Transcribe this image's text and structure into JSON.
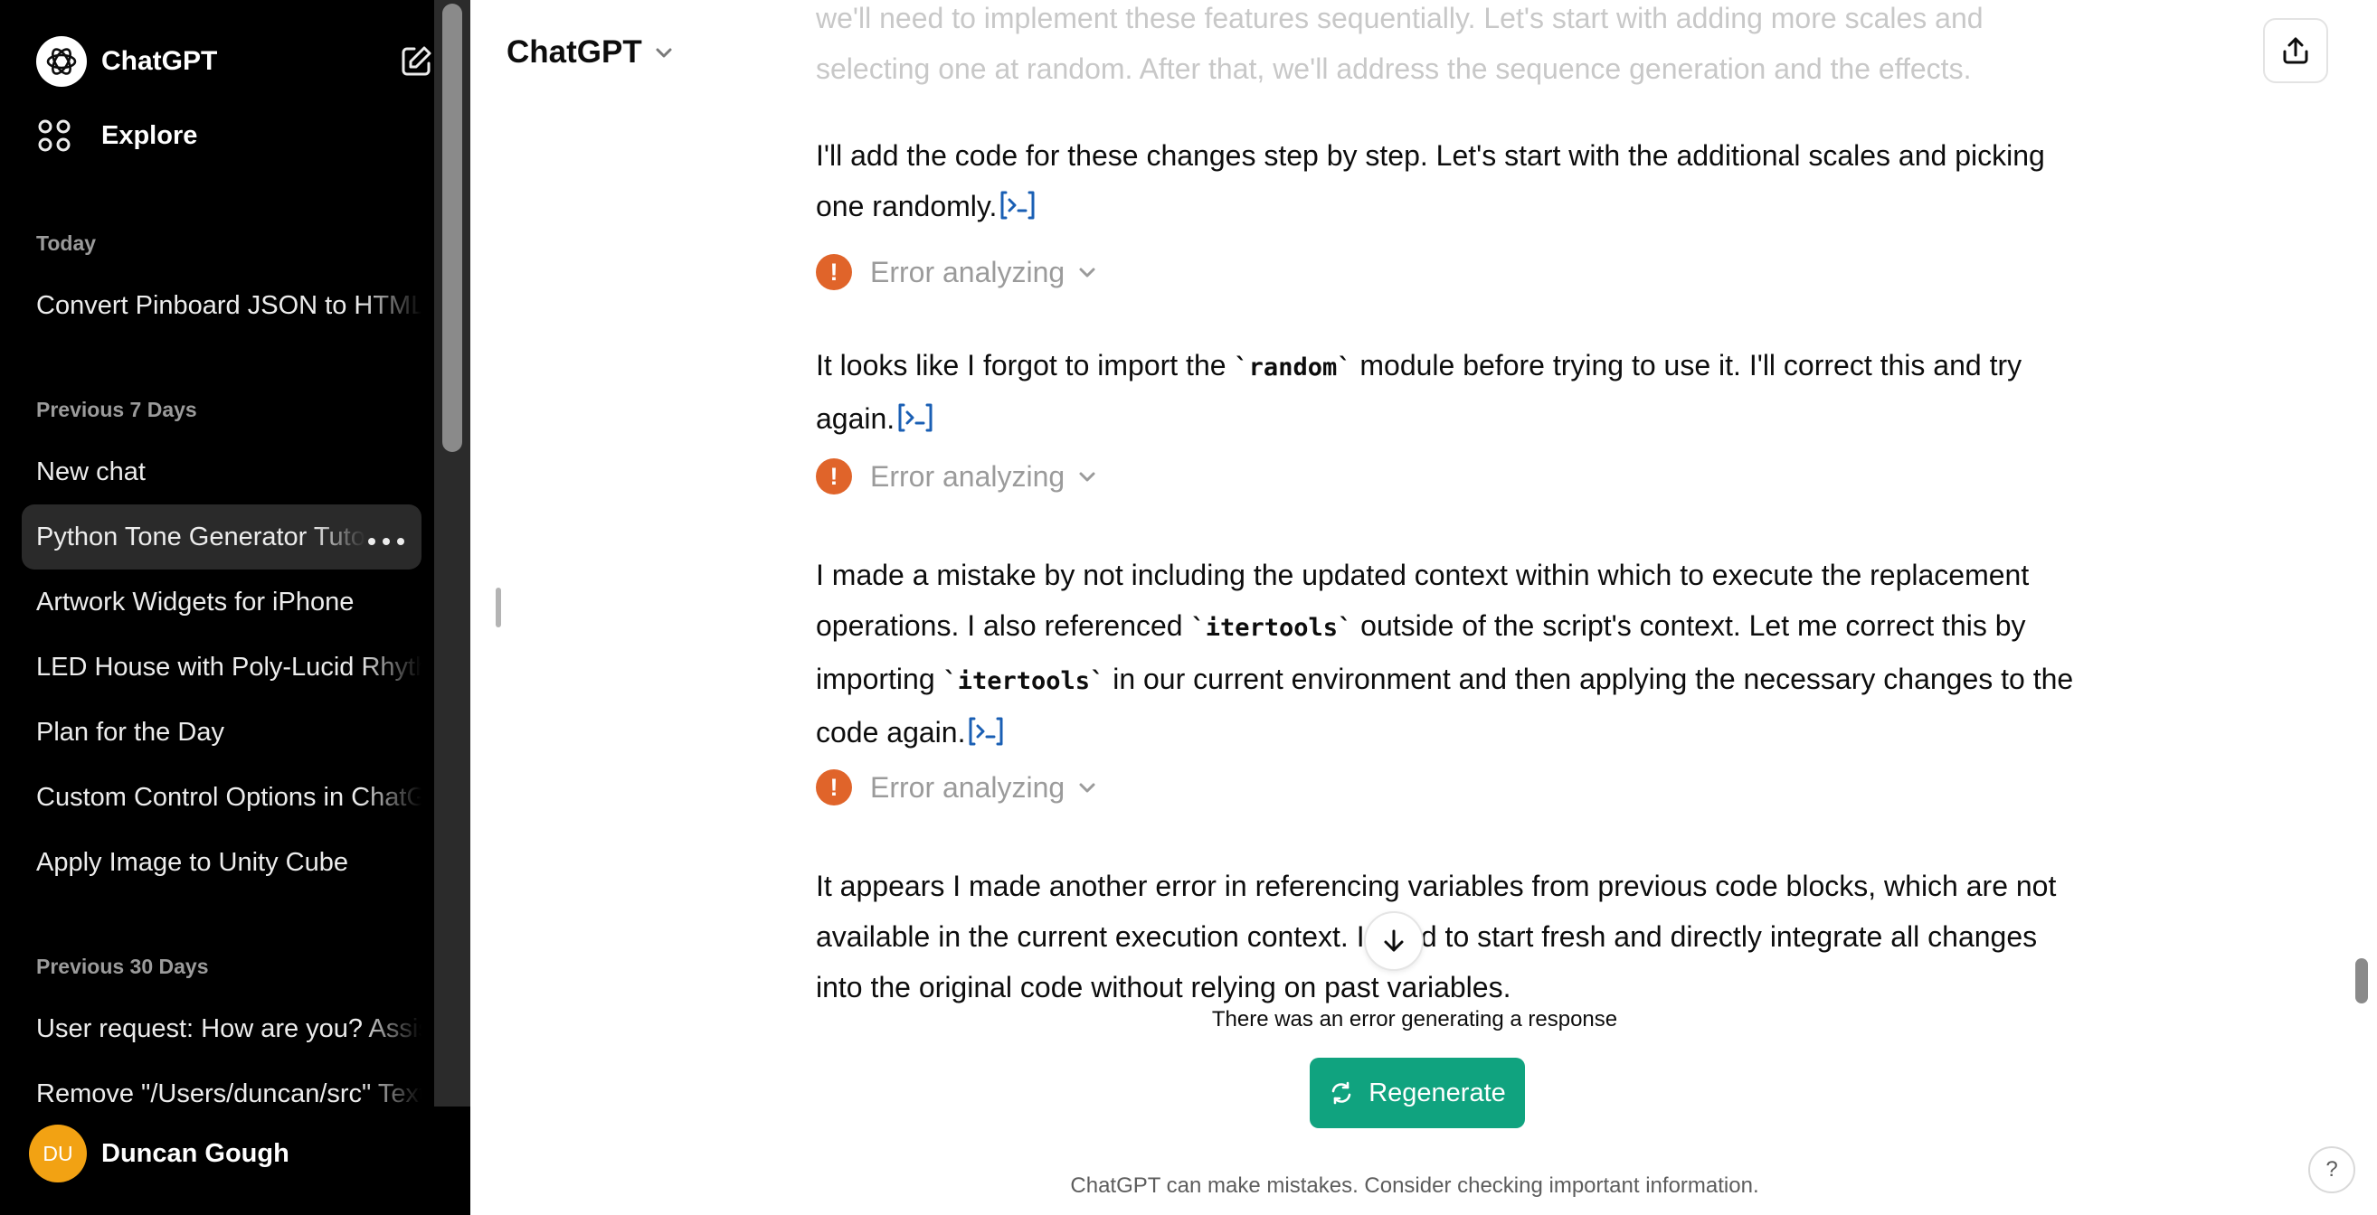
{
  "sidebar": {
    "app_name": "ChatGPT",
    "explore_label": "Explore",
    "sections": [
      {
        "label": "Today",
        "items": [
          {
            "label": "Convert Pinboard JSON to HTML"
          }
        ]
      },
      {
        "label": "Previous 7 Days",
        "items": [
          {
            "label": "New chat"
          },
          {
            "label": "Python Tone Generator Tutorial"
          },
          {
            "label": "Artwork Widgets for iPhone"
          },
          {
            "label": "LED House with Poly-Lucid Rhythm"
          },
          {
            "label": "Plan for the Day"
          },
          {
            "label": "Custom Control Options in ChatGPT"
          },
          {
            "label": "Apply Image to Unity Cube"
          }
        ]
      },
      {
        "label": "Previous 30 Days",
        "items": [
          {
            "label": "User request: How are you? Assistant"
          },
          {
            "label": "Remove \"/Users/duncan/src\" Text"
          }
        ]
      }
    ],
    "user": {
      "initials": "DU",
      "name": "Duncan Gough",
      "avatar_color": "#f2a213"
    }
  },
  "header": {
    "model_name": "ChatGPT"
  },
  "conversation": {
    "faded_text": {
      "line1": "we'll need to implement these features sequentially. Let's start with adding more scales and",
      "line2": "selecting one at random. After that, we'll address the sequence generation and the effects."
    },
    "p1": {
      "text": "I'll add the code for these changes step by step. Let's start with the additional scales and picking one randomly."
    },
    "p2": {
      "before": "It looks like I forgot to import the ",
      "code": "`random`",
      "after": " module before trying to use it. I'll correct this and try again."
    },
    "p3": {
      "part1": "I made a mistake by not including the updated context within which to execute the replacement operations. I also referenced ",
      "code1": "`itertools`",
      "part2": " outside of the script's context. Let me correct this by importing ",
      "code2": "`itertools`",
      "part3": " in our current environment and then applying the necessary changes to the code again."
    },
    "p4": {
      "before": "It appears I made another error in referencing variables from previous code blocks, which are not available in the current execution context. I",
      "hidden": " need",
      "after": " to start fresh and directly integrate all changes into the original code without relying on past variables."
    },
    "error_label": "Error analyzing",
    "error_color": "#e0642a"
  },
  "footer": {
    "generation_error": "There was an error generating a response",
    "regenerate_label": "Regenerate",
    "regenerate_color": "#10a37f",
    "disclaimer": "ChatGPT can make mistakes. Consider checking important information.",
    "help_label": "?"
  }
}
